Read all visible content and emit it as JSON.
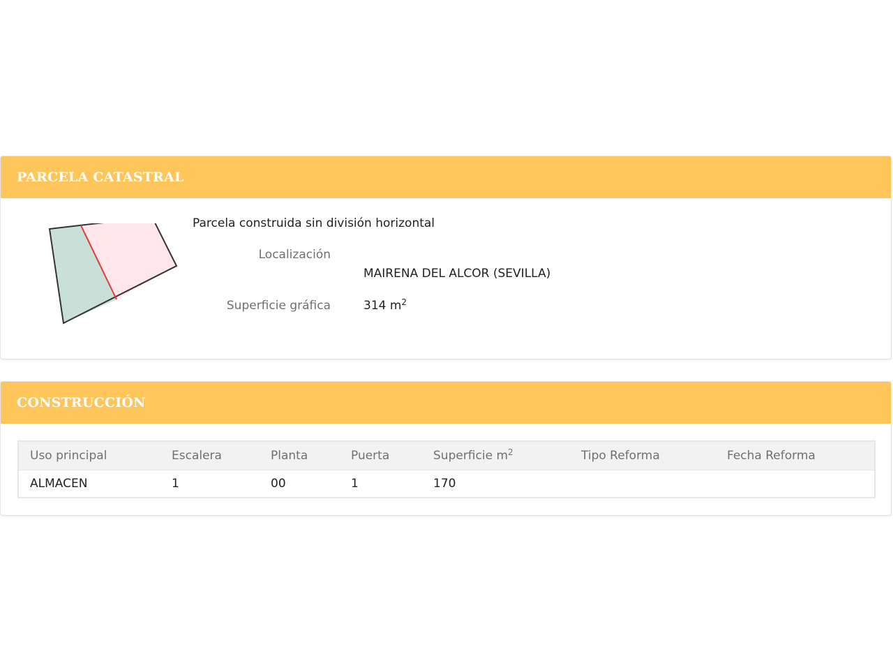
{
  "parcela": {
    "header": "PARCELA CATASTRAL",
    "type_text": "Parcela construida sin división horizontal",
    "localizacion_label": "Localización",
    "localizacion_value": "MAIRENA DEL ALCOR (SEVILLA)",
    "superficie_label": "Superficie gráfica",
    "superficie_value": "314 m",
    "superficie_sup": "2"
  },
  "construccion": {
    "header": "CONSTRUCCIÓN",
    "columns": [
      "Uso principal",
      "Escalera",
      "Planta",
      "Puerta",
      "Superficie m",
      "Tipo Reforma",
      "Fecha Reforma"
    ],
    "superficie_sup": "2",
    "rows": [
      [
        "ALMACEN",
        "1",
        "00",
        "1",
        "170",
        "",
        ""
      ]
    ]
  },
  "colors": {
    "header_bg": "#fec55a",
    "header_text": "#ffffff",
    "parcel_green": "#c8e0d8",
    "parcel_pink": "#ffe6ea",
    "division_line": "#e53935"
  },
  "icons": {
    "parcel_sketch": "parcel-outline-image"
  }
}
